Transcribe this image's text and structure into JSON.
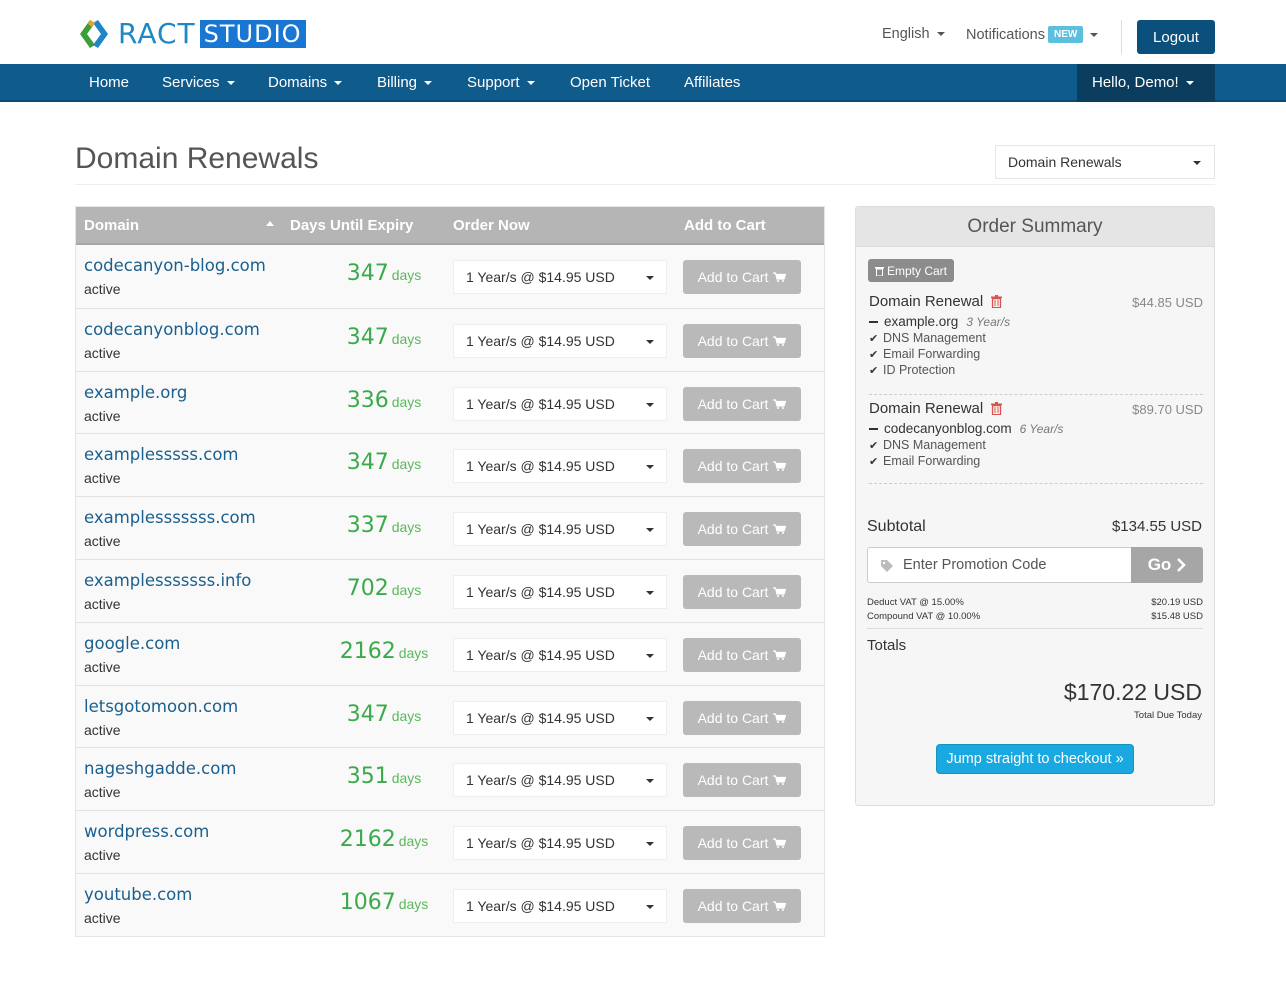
{
  "brand": {
    "name_a": "RACT",
    "name_b": "STUDIO"
  },
  "header": {
    "language": "English",
    "notifications": "Notifications",
    "notifications_badge": "NEW",
    "logout": "Logout"
  },
  "nav": {
    "items": [
      {
        "label": "Home",
        "dropdown": false
      },
      {
        "label": "Services",
        "dropdown": true
      },
      {
        "label": "Domains",
        "dropdown": true
      },
      {
        "label": "Billing",
        "dropdown": true
      },
      {
        "label": "Support",
        "dropdown": true
      },
      {
        "label": "Open Ticket",
        "dropdown": false
      },
      {
        "label": "Affiliates",
        "dropdown": false
      }
    ],
    "user": "Hello, Demo!"
  },
  "page": {
    "title": "Domain Renewals",
    "view_select": "Domain Renewals"
  },
  "table": {
    "headers": {
      "domain": "Domain",
      "days": "Days Until Expiry",
      "order": "Order Now",
      "cart": "Add to Cart"
    },
    "rows": [
      {
        "domain": "codecanyon-blog.com",
        "status": "active",
        "days": "347",
        "unit": "days",
        "option": "1 Year/s @ $14.95 USD",
        "button": "Add to Cart"
      },
      {
        "domain": "codecanyonblog.com",
        "status": "active",
        "days": "347",
        "unit": "days",
        "option": "1 Year/s @ $14.95 USD",
        "button": "Add to Cart"
      },
      {
        "domain": "example.org",
        "status": "active",
        "days": "336",
        "unit": "days",
        "option": "1 Year/s @ $14.95 USD",
        "button": "Add to Cart"
      },
      {
        "domain": "examplesssss.com",
        "status": "active",
        "days": "347",
        "unit": "days",
        "option": "1 Year/s @ $14.95 USD",
        "button": "Add to Cart"
      },
      {
        "domain": "examplesssssss.com",
        "status": "active",
        "days": "337",
        "unit": "days",
        "option": "1 Year/s @ $14.95 USD",
        "button": "Add to Cart"
      },
      {
        "domain": "examplesssssss.info",
        "status": "active",
        "days": "702",
        "unit": "days",
        "option": "1 Year/s @ $14.95 USD",
        "button": "Add to Cart"
      },
      {
        "domain": "google.com",
        "status": "active",
        "days": "2162",
        "unit": "days",
        "option": "1 Year/s @ $14.95 USD",
        "button": "Add to Cart"
      },
      {
        "domain": "letsgotomoon.com",
        "status": "active",
        "days": "347",
        "unit": "days",
        "option": "1 Year/s @ $14.95 USD",
        "button": "Add to Cart"
      },
      {
        "domain": "nageshgadde.com",
        "status": "active",
        "days": "351",
        "unit": "days",
        "option": "1 Year/s @ $14.95 USD",
        "button": "Add to Cart"
      },
      {
        "domain": "wordpress.com",
        "status": "active",
        "days": "2162",
        "unit": "days",
        "option": "1 Year/s @ $14.95 USD",
        "button": "Add to Cart"
      },
      {
        "domain": "youtube.com",
        "status": "active",
        "days": "1067",
        "unit": "days",
        "option": "1 Year/s @ $14.95 USD",
        "button": "Add to Cart"
      }
    ]
  },
  "summary": {
    "title": "Order Summary",
    "empty_cart": "Empty Cart",
    "items": [
      {
        "title": "Domain Renewal",
        "price": "$44.85 USD",
        "domain": "example.org",
        "years": "3 Year/s",
        "addons": [
          "DNS Management",
          "Email Forwarding",
          "ID Protection"
        ]
      },
      {
        "title": "Domain Renewal",
        "price": "$89.70 USD",
        "domain": "codecanyonblog.com",
        "years": "6 Year/s",
        "addons": [
          "DNS Management",
          "Email Forwarding"
        ]
      }
    ],
    "subtotal_label": "Subtotal",
    "subtotal": "$134.55 USD",
    "promo_placeholder": "Enter Promotion Code",
    "go": "Go",
    "taxes": [
      {
        "label": "Deduct VAT @ 15.00%",
        "value": "$20.19 USD"
      },
      {
        "label": "Compound VAT @ 10.00%",
        "value": "$15.48 USD"
      }
    ],
    "totals_label": "Totals",
    "total": "$170.22 USD",
    "total_sub": "Total Due Today",
    "checkout": "Jump straight to checkout »"
  },
  "colors": {
    "nav": "#0f5b8c",
    "accent": "#1e88c7",
    "days": "#3aaa4a",
    "checkout": "#19a9e0",
    "trash": "#d9534f"
  },
  "icons": [
    "brand-logo-icon",
    "caret-down-icon",
    "sort-icon",
    "cart-icon",
    "trash-icon",
    "check-icon",
    "tag-icon",
    "chevron-right-icon"
  ]
}
